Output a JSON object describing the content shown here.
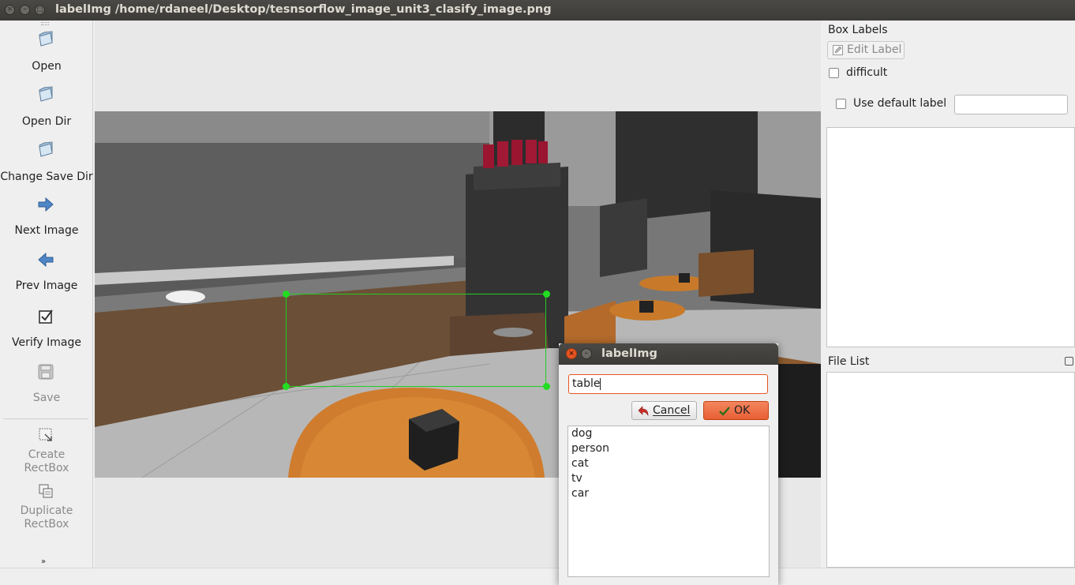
{
  "window": {
    "title": "labelImg /home/rdaneel/Desktop/tesnsorflow_image_unit3_clasify_image.png"
  },
  "toolbar": {
    "items": [
      {
        "label": "Open",
        "icon": "open-folder-icon",
        "enabled": true
      },
      {
        "label": "Open Dir",
        "icon": "open-folder-icon",
        "enabled": true
      },
      {
        "label": "Change Save Dir",
        "icon": "open-folder-icon",
        "enabled": true
      },
      {
        "label": "Next Image",
        "icon": "arrow-right-icon",
        "enabled": true
      },
      {
        "label": "Prev Image",
        "icon": "arrow-left-icon",
        "enabled": true
      },
      {
        "label": "Verify Image",
        "icon": "checkbox-icon",
        "enabled": true
      },
      {
        "label": "Save",
        "icon": "save-icon",
        "enabled": false
      },
      {
        "label_line1": "Create",
        "label_line2": "RectBox",
        "icon": "create-rectbox-icon",
        "enabled": false
      },
      {
        "label_line1": "Duplicate",
        "label_line2": "RectBox",
        "icon": "duplicate-rectbox-icon",
        "enabled": false
      }
    ]
  },
  "dock": {
    "box_labels_title": "Box Labels",
    "edit_label_button": "Edit Label",
    "difficult_label": "difficult",
    "difficult_checked": false,
    "use_default_label": "Use default label",
    "use_default_checked": false,
    "default_label_value": "",
    "file_list_title": "File List"
  },
  "dialog": {
    "title": "labelImg",
    "input_value": "table",
    "cancel_label": "Cancel",
    "ok_label": "OK",
    "labels": [
      "dog",
      "person",
      "cat",
      "tv",
      "car"
    ]
  },
  "colors": {
    "accent": "#e95420",
    "bbox": "#22cc22"
  }
}
